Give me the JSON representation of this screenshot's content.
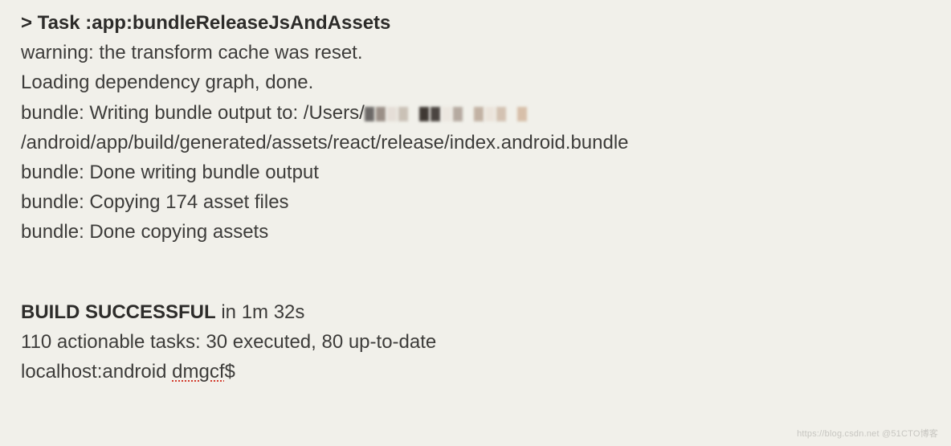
{
  "task_prefix": "> Task ",
  "task_name": ":app:bundleReleaseJsAndAssets",
  "lines": {
    "warn": "warning: the transform cache was reset.",
    "loading": "Loading dependency graph, done.",
    "write_before": "bundle: Writing bundle output to: /Users/",
    "write_after": "/android/app/build/generated/assets/react/release/index.android.bundle",
    "done_write": "bundle: Done writing bundle output",
    "copying": "bundle: Copying 174 asset files",
    "done_copy": "bundle: Done copying assets"
  },
  "build": {
    "status": "BUILD SUCCESSFUL",
    "timing": " in 1m 32s",
    "summary": "110 actionable tasks: 30 executed, 80 up-to-date",
    "prompt_before": "localhost:android ",
    "prompt_user": "dmgcf",
    "prompt_after": "$"
  },
  "censor_colors": [
    "#6b6866",
    "#9a8f87",
    "#e5ded7",
    "#cac1b6",
    "#3f3833",
    "#4a4440",
    "#ece7e0",
    "#b5aaa0",
    "#c2b2a3",
    "#ebe4db",
    "#d3c2b2",
    "#d7bfa9"
  ],
  "watermark": "https://blog.csdn.net @51CTO博客"
}
